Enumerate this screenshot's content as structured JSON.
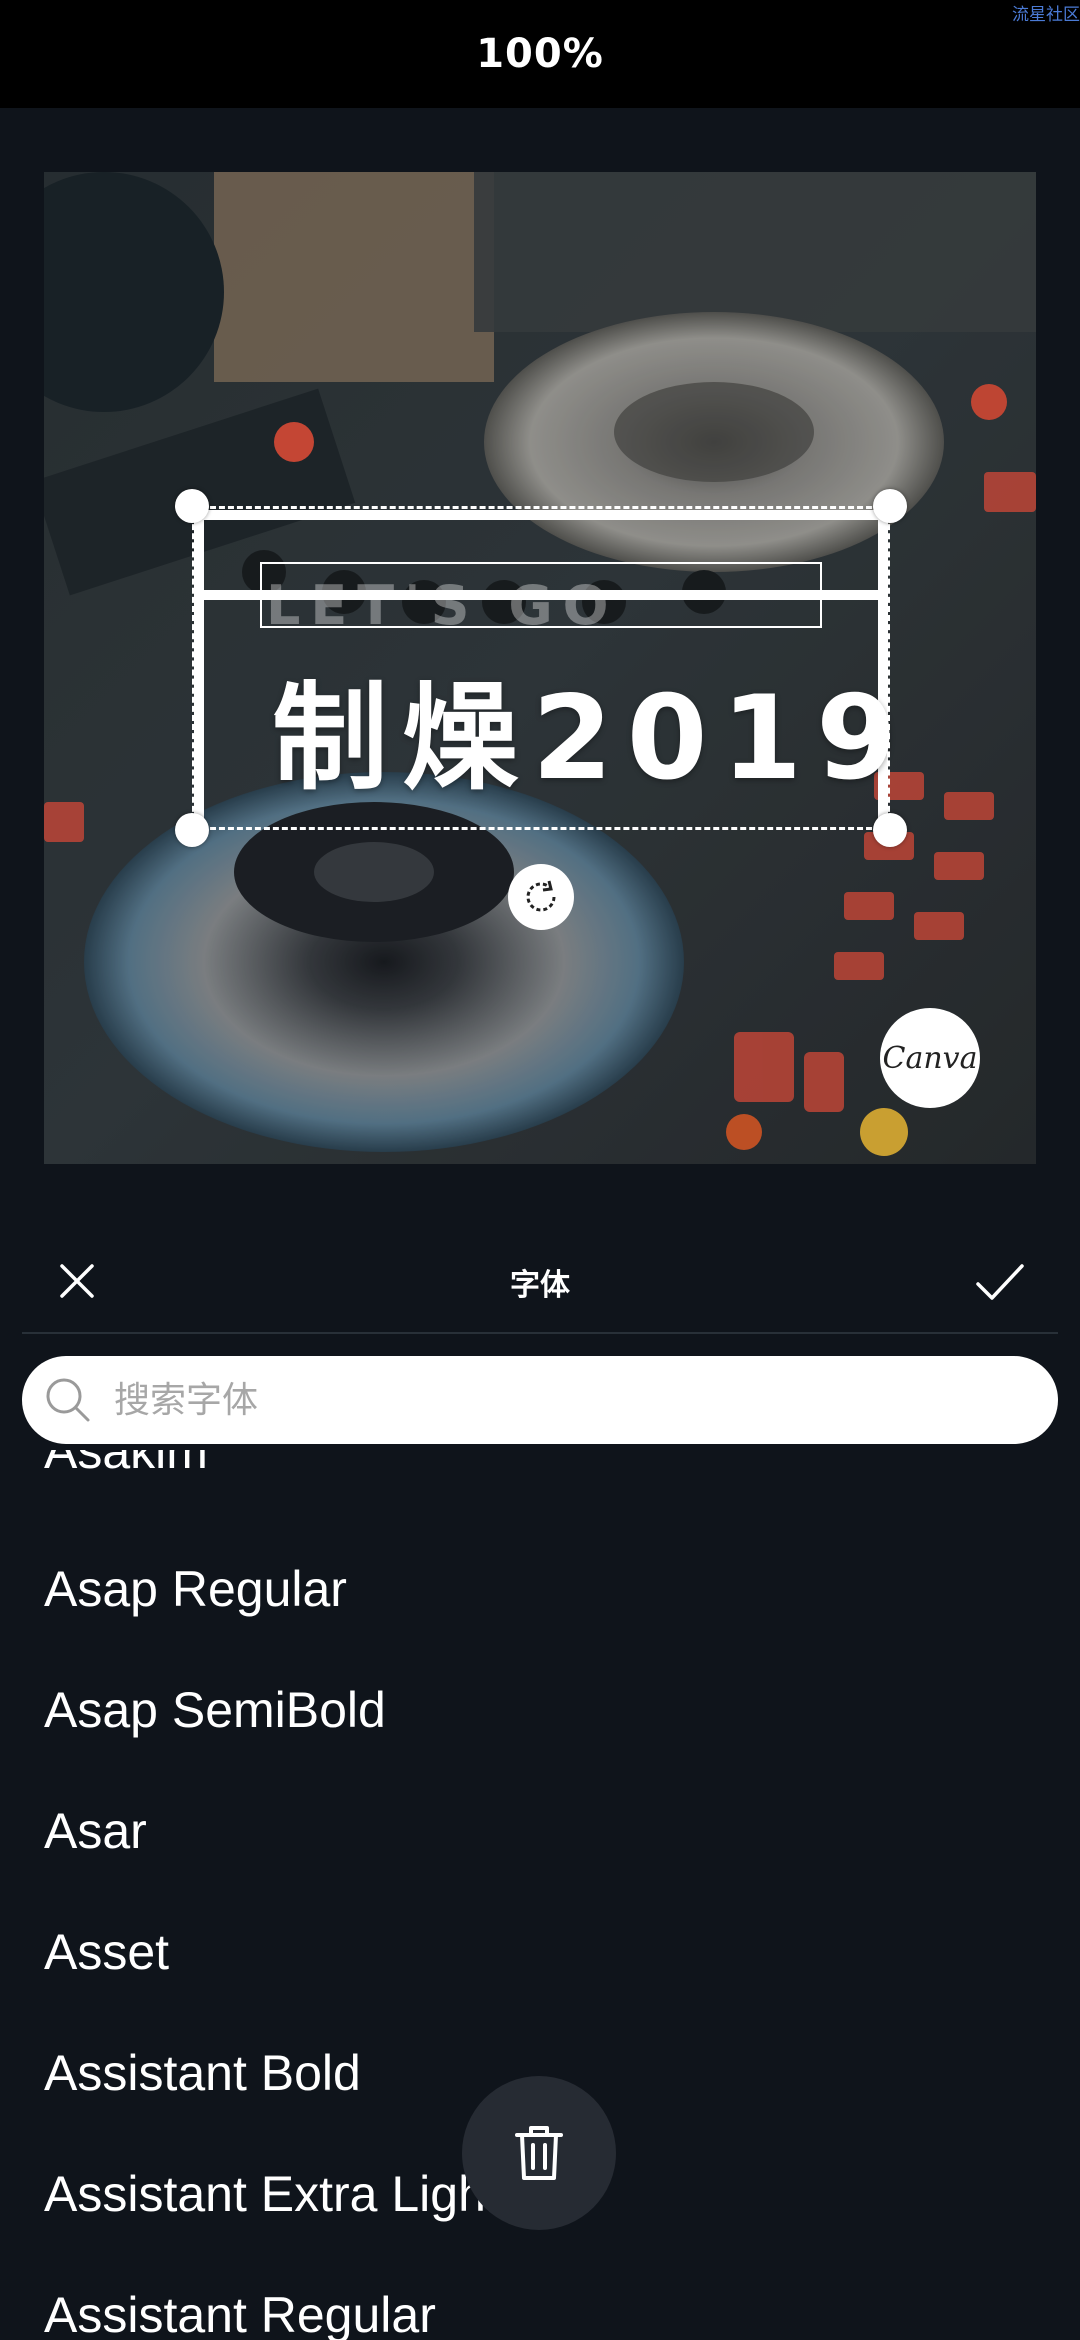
{
  "status": {
    "zoom": "100%",
    "watermark": "流星社区"
  },
  "design": {
    "subtitle": "LET'S GO",
    "headline": "制燥2019",
    "badge": "Canva"
  },
  "panel": {
    "title": "字体",
    "close_icon": "close-icon",
    "confirm_icon": "check-icon"
  },
  "search": {
    "placeholder": "搜索字体",
    "value": ""
  },
  "fonts": [
    "Asakim",
    "Asap Regular",
    "Asap SemiBold",
    "Asar",
    "Asset",
    "Assistant Bold",
    "Assistant Extra Light",
    "Assistant Regular"
  ],
  "actions": {
    "delete_icon": "trash-icon"
  }
}
